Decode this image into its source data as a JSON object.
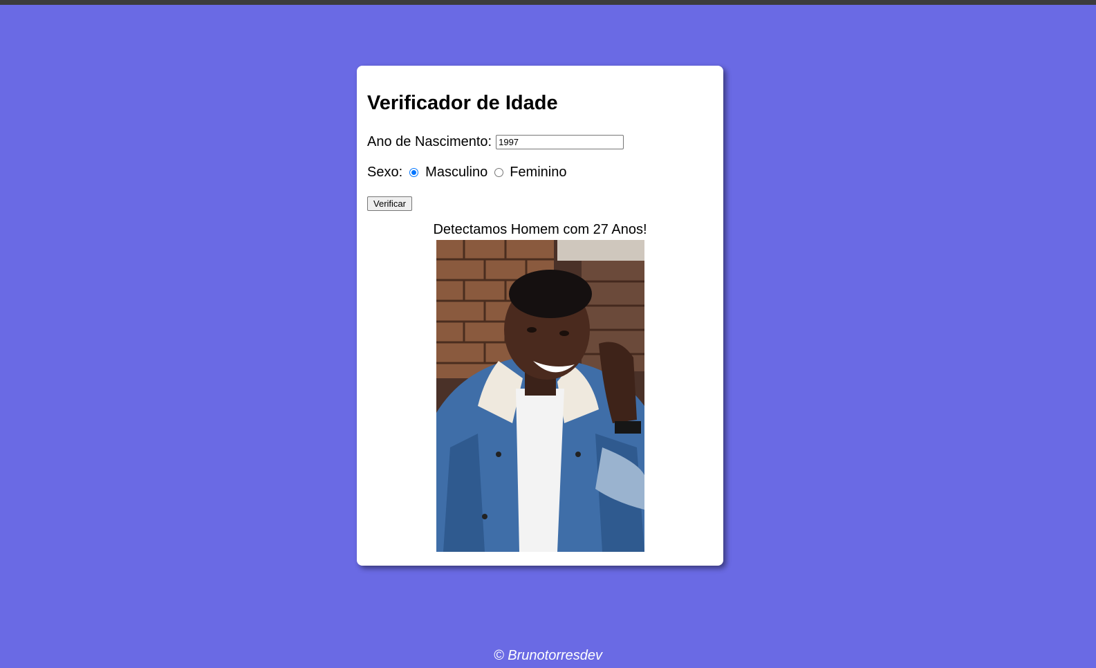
{
  "page": {
    "title": "Verificador de Idade",
    "background_color": "#6a6ae4"
  },
  "form": {
    "year_label": "Ano de Nascimento:",
    "year_value": "1997",
    "sex_label": "Sexo:",
    "sex_options": [
      {
        "label": "Masculino",
        "checked": true
      },
      {
        "label": "Feminino",
        "checked": false
      }
    ],
    "verify_label": "Verificar"
  },
  "result": {
    "text": "Detectamos Homem com 27 Anos!",
    "image_icon": "photo-young-man"
  },
  "footer": {
    "text": "© Brunotorresdev"
  }
}
